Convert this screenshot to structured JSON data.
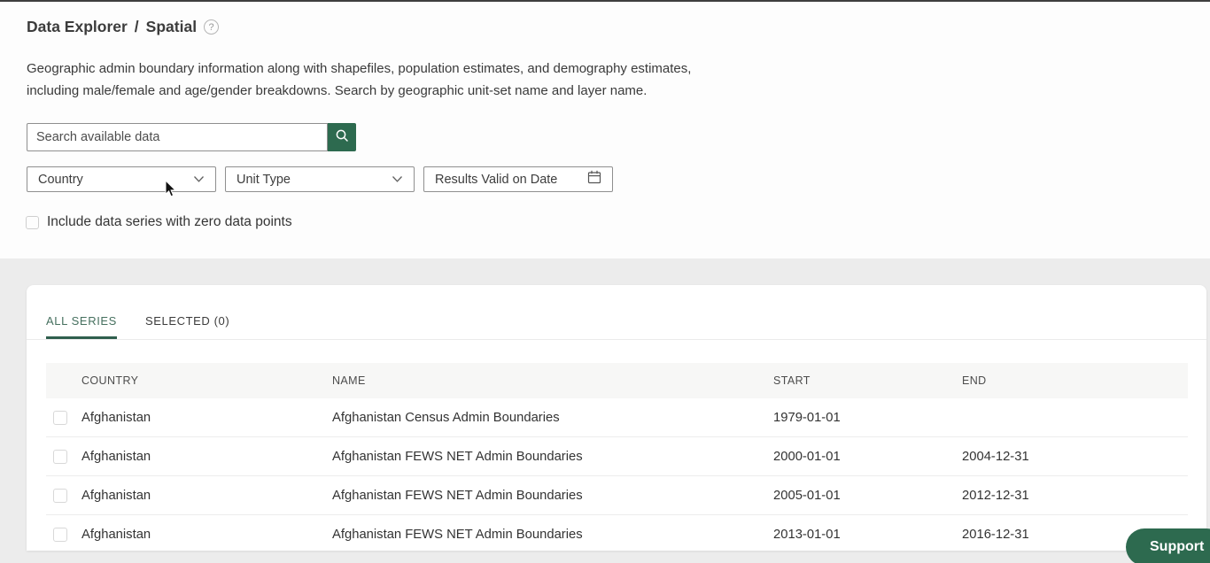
{
  "colors": {
    "primary_green": "#2d6a4f",
    "tab_active_green": "#46705f",
    "tab_underline_green": "#2f5f4e",
    "page_background": "#ececec",
    "table_header_bg": "#f7f7f6"
  },
  "header": {
    "breadcrumb_root": "Data Explorer",
    "breadcrumb_separator": "/",
    "breadcrumb_current": "Spatial",
    "help_icon": "?",
    "description_line1": "Geographic admin boundary information along with shapefiles, population estimates, and demography estimates,",
    "description_line2": "including male/female and age/gender breakdowns. Search by geographic unit-set name and layer name."
  },
  "filters": {
    "search_placeholder": "Search available data",
    "search_value": "",
    "country_dropdown_label": "Country",
    "unit_type_dropdown_label": "Unit Type",
    "valid_date_filter_label": "Results Valid on Date",
    "zero_series_checkbox_label": "Include data series with zero data points",
    "zero_series_checked": false
  },
  "tabs": {
    "all_series_label": "ALL SERIES",
    "selected_label": "SELECTED (0)"
  },
  "table": {
    "headers": {
      "country": "COUNTRY",
      "name": "NAME",
      "start": "START",
      "end": "END"
    },
    "rows": [
      {
        "country": "Afghanistan",
        "name": "Afghanistan Census Admin Boundaries",
        "start": "1979-01-01",
        "end": ""
      },
      {
        "country": "Afghanistan",
        "name": "Afghanistan FEWS NET Admin Boundaries",
        "start": "2000-01-01",
        "end": "2004-12-31"
      },
      {
        "country": "Afghanistan",
        "name": "Afghanistan FEWS NET Admin Boundaries",
        "start": "2005-01-01",
        "end": "2012-12-31"
      },
      {
        "country": "Afghanistan",
        "name": "Afghanistan FEWS NET Admin Boundaries",
        "start": "2013-01-01",
        "end": "2016-12-31"
      }
    ]
  },
  "support": {
    "label": "Support"
  }
}
